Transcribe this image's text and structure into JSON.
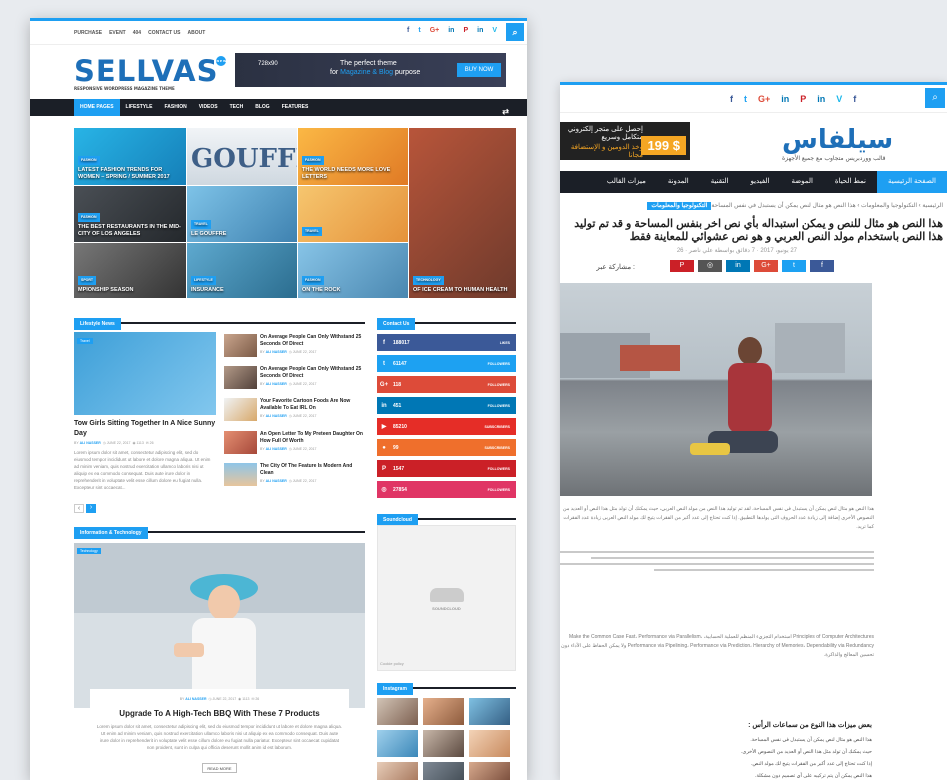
{
  "rtl": {
    "social": [
      "f",
      "t",
      "G+",
      "in",
      "P",
      "in",
      "V",
      "f"
    ],
    "ad_text": [
      "إحصل على متجر إلكتروني متكامل وسريع",
      "وخذ الدومين و الإستضافة مجانا"
    ],
    "ad_price": "199 $",
    "logo": "سيلفاس",
    "logo_sub": "قالب ووردبريس متجاوب مع جميع الأجهزة",
    "nav": [
      "الصفحة الرئيسية",
      "نمط الحياة",
      "الموضة",
      "الفيديو",
      "التقنية",
      "المدونة",
      "ميزات القالب"
    ],
    "breadcrumb_tag": "التكنولوجيا والمعلومات",
    "breadcrumb": "الرئيسية  ›  التكنولوجيا والمعلومات  ›  هذا النص هو مثال لنص يمكن أن يستبدل في نفس المساحة",
    "title": "هذا النص هو مثال للنص و يمكن استبداله بأي نص اخر بنفس المساحة و قد تم توليد هذا النص باستخدام مولد النص العربي و هو نص عشوائي للمعاينة فقط",
    "meta": "27 يونيو، 2017  ·  7 دقائق بواسطة علي ناصر  ·  26",
    "share_label": "مشاركة عبر :",
    "share_colors": [
      "#3b5998",
      "#1da1f2",
      "#dd4b39",
      "#0077b5",
      "#555",
      "#cb2027"
    ],
    "share_icons": [
      "f",
      "t",
      "G+",
      "in",
      "◎",
      "P"
    ],
    "intro": "هذا النص هو مثال لنص يمكن أن يستبدل في نفس المساحة، لقد تم توليد هذا النص من مولد النص العربي، حيث يمكنك أن تولد مثل هذا النص أو العديد من النصوص الأخرى إضافة إلى زيادة عدد الحروف التى يولدها التطبيق. إذا كنت تحتاج إلى عدد أكبر من الفقرات يتيح لك مولد النص العربى زيادة عدد الفقرات كما تريد.",
    "body1": "Principles of Computer Architectures استخدام التجزيء المنظم للعملية الحسابية، Make the Common Case Fast، Performance via Parallelism، Performance via Pipelining، Performance via Prediction، Hierarchy of Memories، Dependability via Redundancy ولا يمكن الحفاظ على الأداء دون تحسين المعالج والذاكرة.",
    "h3": "بعض ميزات هذا النوع من سماعات الرأس :",
    "bullets": [
      "هذا النص هو مثال لنص يمكن أن يستبدل في نفس المساحة.",
      "حيث يمكنك أن تولد مثل هذا النص أو العديد من النصوص الأخرى.",
      "إذا كنت تحتاج إلى عدد أكبر من الفقرات يتيح لك مولد النص.",
      "هذا النص يمكن أن يتم تركيبه على أي تصميم دون مشكلة."
    ]
  },
  "topbar": {
    "links": [
      "PURCHASE",
      "EVENT",
      "404",
      "CONTACT US",
      "ABOUT"
    ],
    "social": [
      "f",
      "t",
      "G+",
      "in",
      "P",
      "in",
      "V",
      "f"
    ],
    "search_icon": "⌕"
  },
  "logo": {
    "text": "SELLVAS",
    "tagline": "RESPONSIVE WORDPRESS MAGAZINE THEME",
    "badge": "NEW"
  },
  "ad": {
    "size": "728x90",
    "line1": "The perfect theme",
    "line2_pre": "for ",
    "line2_hl": "Magazine & Blog",
    "line2_post": " purpose",
    "button": "BUY NOW"
  },
  "nav": {
    "items": [
      "HOME PAGES",
      "LIFESTYLE",
      "FASHION",
      "VIDEOS",
      "TECH",
      "BLOG",
      "FEATURES"
    ],
    "shuffle_icon": "⇄"
  },
  "magazine": [
    {
      "cat": "FASHION",
      "title": "LATEST FASHION TRENDS FOR WOMEN – SPRING / SUMMER 2017",
      "bg": "linear-gradient(135deg,#28b4e6,#157fb8)"
    },
    {
      "cat": "",
      "title": "",
      "bg": "linear-gradient(180deg,#f1f4f7,#cfd8e0)",
      "img_text": "GOUFFE"
    },
    {
      "cat": "FASHION",
      "title": "THE WORLD NEEDS MORE LOVE LETTERS",
      "bg": "linear-gradient(135deg,#fbb845,#e07a25)"
    },
    {
      "cat": "",
      "title": "",
      "bg": "linear-gradient(135deg,#b8553a,#6e3a2c)"
    },
    {
      "cat": "FASHION",
      "title": "THE BEST RESTAURANTS IN THE MID-CITY OF LOS ANGELES",
      "bg": "linear-gradient(135deg,#4a4f55,#24282c)"
    },
    {
      "cat": "TRAVEL",
      "title": "LE GOUFFRE",
      "bg": "linear-gradient(135deg,#7ec3e8,#3f82b0)"
    },
    {
      "cat": "TRAVEL",
      "title": "",
      "bg": "linear-gradient(135deg,#f6c66f,#e5923a)"
    },
    {
      "cat": "SPORT",
      "title": "MPIONSHIP SEASON",
      "bg": "linear-gradient(135deg,#777,#333)"
    },
    {
      "cat": "LIFESTYLE",
      "title": "INSURANCE",
      "bg": "linear-gradient(135deg,#5ea9cf,#2b6d8f)"
    },
    {
      "cat": "FASHION",
      "title": "ON THE ROCK",
      "bg": "linear-gradient(135deg,#87c4e7,#4a87b0)"
    },
    {
      "cat": "TECHNOLOGY",
      "title": "OF ICE CREAM TO HUMAN HEALTH",
      "bg": "linear-gradient(135deg,#c1735a,#6d3a2a)"
    },
    {
      "cat": "",
      "title": "YOU",
      "bg": "#444"
    }
  ],
  "lifestyle": {
    "header": "Lifestyle News",
    "big": {
      "cat": "Travel",
      "title": "Tow Girls Sitting Together In A Nice Sunny Day",
      "by": "BY ",
      "author": "ALI NASSER",
      "date": "JUNE 22, 2017",
      "views": "1113",
      "comments": "26",
      "excerpt": "Lorem ipsum dolor sit amet, consectetur adipiscing elit, sed do eiusmod tempor incididunt ut labore et dolore magna aliqua. Ut enim ad minim veniam, quis nostrud exercitation ullamco laboris nisi ut aliquip ex ea commodo consequat. Duis aute irure dolor in reprehenderit in voluptate velit esse cillum dolore eu fugiat nulla. Excepteur sint occaecat..."
    },
    "list": [
      {
        "title": "On Average People Can Only Withstand 25 Seconds Of Direct",
        "author": "ALI NASSER",
        "date": "JUNE 22, 2017"
      },
      {
        "title": "On Average People Can Only Withstand 25 Seconds Of Direct",
        "author": "ALI NASSER",
        "date": "JUNE 22, 2017"
      },
      {
        "title": "Your Favorite Cartoon Foods Are Now Available To Eat IRL On",
        "author": "ALI NASSER",
        "date": "JUNE 22, 2017"
      },
      {
        "title": "An Open Letter To My Preteen Daughter On How Full Of Worth",
        "author": "ALI NASSER",
        "date": "JUNE 22, 2017"
      },
      {
        "title": "The City Of The Feature Is Modern And Clean",
        "author": "ALI NASSER",
        "date": "JUNE 22, 2017"
      }
    ],
    "prev": "‹",
    "next": "›"
  },
  "infotech": {
    "header": "Information & Technology",
    "cat": "Technology",
    "by": "BY ",
    "author": "ALI NASSER",
    "date": "JUNE 22, 2017",
    "views": "1113",
    "comments": "26",
    "title": "Upgrade To A High-Tech BBQ With These 7 Products",
    "excerpt": "Lorem ipsum dolor sit amet, consectetur adipiscing elit, sed do eiusmod tempor incididunt ut labore et dolore magna aliqua. Ut enim ad minim veniam, quis nostrud exercitation ullamco laboris nisi ut aliquip ex ea commodo consequat. Duis aute irure dolor in reprehenderit in voluptate velit esse cillum dolore eu fugiat nulla pariatur. Excepteur sint occaecat cupidatat non proident, sunt in culpa qui officia deserunt mollit anim id est laborum.",
    "read_more": "READ MORE"
  },
  "contact": {
    "header": "Contact Us",
    "items": [
      {
        "icon": "f",
        "count": "188017",
        "label": "LIKES",
        "color": "#3b5998"
      },
      {
        "icon": "t",
        "count": "61147",
        "label": "FOLLOWERS",
        "color": "#1da1f2"
      },
      {
        "icon": "G+",
        "count": "118",
        "label": "FOLLOWERS",
        "color": "#dd4b39"
      },
      {
        "icon": "in",
        "count": "451",
        "label": "FOLLOWERS",
        "color": "#0077b5"
      },
      {
        "icon": "▶",
        "count": "85210",
        "label": "SUBSCRIBERS",
        "color": "#e52d27"
      },
      {
        "icon": "●",
        "count": "99",
        "label": "SUBSCRIBERS",
        "color": "#ef6f2c"
      },
      {
        "icon": "P",
        "count": "1547",
        "label": "FOLLOWERS",
        "color": "#cb2027"
      },
      {
        "icon": "◎",
        "count": "27854",
        "label": "FOLLOWERS",
        "color": "#e03565"
      }
    ]
  },
  "soundcloud": {
    "header": "Soundcloud",
    "brand": "SOUNDCLOUD",
    "cookie": "Cookie policy"
  },
  "instagram": {
    "header": "Instagram"
  }
}
